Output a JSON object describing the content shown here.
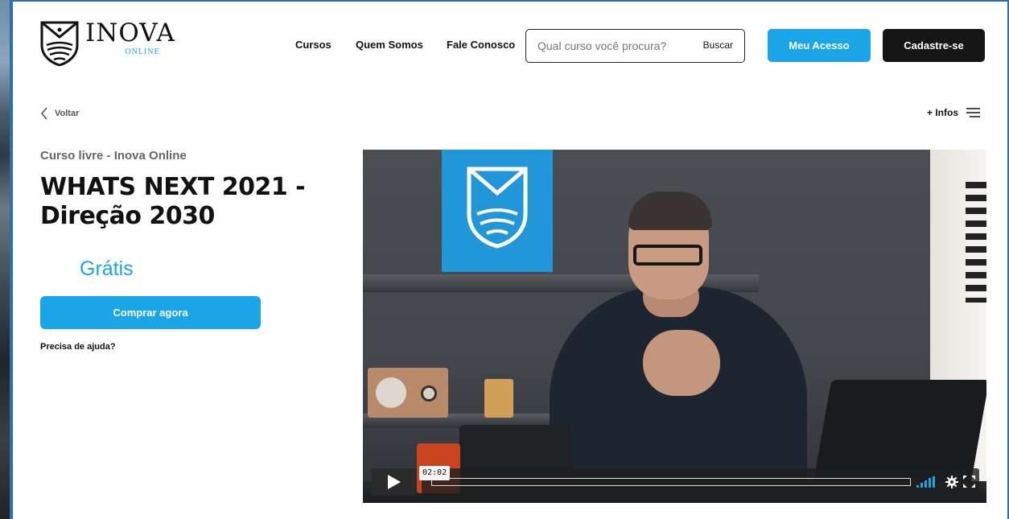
{
  "brand": {
    "name": "INOVA",
    "sub": "ONLINE"
  },
  "nav": {
    "cursos": "Cursos",
    "quem_somos": "Quem Somos",
    "fale_conosco": "Fale Conosco"
  },
  "search": {
    "placeholder": "Qual curso você procura?",
    "button": "Buscar"
  },
  "header_buttons": {
    "meu_acesso": "Meu Acesso",
    "cadastre": "Cadastre-se"
  },
  "toolbar": {
    "voltar": "Voltar",
    "infos": "+ Infos"
  },
  "course": {
    "subtitle": "Curso livre - Inova Online",
    "title": "WHATS NEXT 2021 - Direção 2030",
    "price": "Grátis",
    "buy_label": "Comprar agora",
    "help": "Precisa de ajuda?"
  },
  "video": {
    "timecode": "02:02"
  },
  "colors": {
    "accent": "#1aa6e6",
    "dark": "#161616",
    "frame": "#2a6fb7"
  },
  "icons": [
    "chevron-left-icon",
    "menu-icon",
    "play-icon",
    "volume-icon",
    "settings-icon",
    "fullscreen-icon",
    "shield-logo-icon"
  ]
}
